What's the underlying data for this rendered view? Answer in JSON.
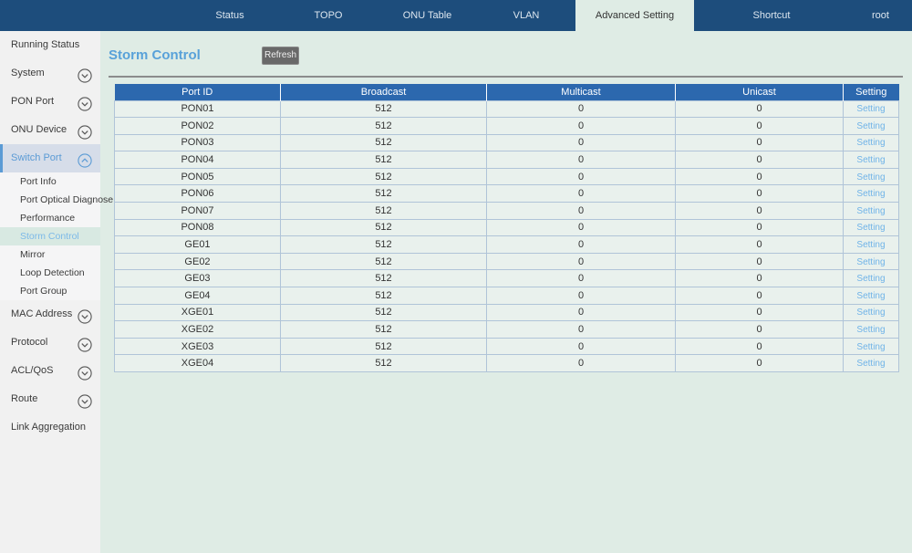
{
  "nav": {
    "tabs": [
      {
        "label": "Status",
        "active": false
      },
      {
        "label": "TOPO",
        "active": false
      },
      {
        "label": "ONU Table",
        "active": false
      },
      {
        "label": "VLAN",
        "active": false
      },
      {
        "label": "Advanced Setting",
        "active": true
      },
      {
        "label": "Shortcut",
        "active": false
      },
      {
        "label": "root",
        "active": false
      }
    ]
  },
  "sidebar": {
    "items": [
      {
        "label": "Running Status",
        "level": "top",
        "chevron": null,
        "active": false
      },
      {
        "label": "System",
        "level": "top",
        "chevron": "down",
        "active": false
      },
      {
        "label": "PON Port",
        "level": "top",
        "chevron": "down",
        "active": false
      },
      {
        "label": "ONU Device",
        "level": "top",
        "chevron": "down",
        "active": false
      },
      {
        "label": "Switch Port",
        "level": "top",
        "chevron": "up",
        "active": true
      },
      {
        "label": "Port Info",
        "level": "sub",
        "chevron": null,
        "active": false
      },
      {
        "label": "Port Optical Diagnose",
        "level": "sub",
        "chevron": null,
        "active": false
      },
      {
        "label": "Performance",
        "level": "sub",
        "chevron": null,
        "active": false
      },
      {
        "label": "Storm Control",
        "level": "sub",
        "chevron": null,
        "active": true
      },
      {
        "label": "Mirror",
        "level": "sub",
        "chevron": null,
        "active": false
      },
      {
        "label": "Loop Detection",
        "level": "sub",
        "chevron": null,
        "active": false
      },
      {
        "label": "Port Group",
        "level": "sub",
        "chevron": null,
        "active": false
      },
      {
        "label": "MAC Address",
        "level": "top",
        "chevron": "down",
        "active": false
      },
      {
        "label": "Protocol",
        "level": "top",
        "chevron": "down",
        "active": false
      },
      {
        "label": "ACL/QoS",
        "level": "top",
        "chevron": "down",
        "active": false
      },
      {
        "label": "Route",
        "level": "top",
        "chevron": "down",
        "active": false
      },
      {
        "label": "Link Aggregation",
        "level": "top",
        "chevron": null,
        "active": false
      }
    ]
  },
  "main": {
    "title": "Storm Control",
    "refresh_label": "Refresh",
    "table": {
      "headers": [
        "Port ID",
        "Broadcast",
        "Multicast",
        "Unicast",
        "Setting"
      ],
      "rows": [
        {
          "port_id": "PON01",
          "broadcast": "512",
          "multicast": "0",
          "unicast": "0",
          "setting": "Setting"
        },
        {
          "port_id": "PON02",
          "broadcast": "512",
          "multicast": "0",
          "unicast": "0",
          "setting": "Setting"
        },
        {
          "port_id": "PON03",
          "broadcast": "512",
          "multicast": "0",
          "unicast": "0",
          "setting": "Setting"
        },
        {
          "port_id": "PON04",
          "broadcast": "512",
          "multicast": "0",
          "unicast": "0",
          "setting": "Setting"
        },
        {
          "port_id": "PON05",
          "broadcast": "512",
          "multicast": "0",
          "unicast": "0",
          "setting": "Setting"
        },
        {
          "port_id": "PON06",
          "broadcast": "512",
          "multicast": "0",
          "unicast": "0",
          "setting": "Setting"
        },
        {
          "port_id": "PON07",
          "broadcast": "512",
          "multicast": "0",
          "unicast": "0",
          "setting": "Setting"
        },
        {
          "port_id": "PON08",
          "broadcast": "512",
          "multicast": "0",
          "unicast": "0",
          "setting": "Setting"
        },
        {
          "port_id": "GE01",
          "broadcast": "512",
          "multicast": "0",
          "unicast": "0",
          "setting": "Setting"
        },
        {
          "port_id": "GE02",
          "broadcast": "512",
          "multicast": "0",
          "unicast": "0",
          "setting": "Setting"
        },
        {
          "port_id": "GE03",
          "broadcast": "512",
          "multicast": "0",
          "unicast": "0",
          "setting": "Setting"
        },
        {
          "port_id": "GE04",
          "broadcast": "512",
          "multicast": "0",
          "unicast": "0",
          "setting": "Setting"
        },
        {
          "port_id": "XGE01",
          "broadcast": "512",
          "multicast": "0",
          "unicast": "0",
          "setting": "Setting"
        },
        {
          "port_id": "XGE02",
          "broadcast": "512",
          "multicast": "0",
          "unicast": "0",
          "setting": "Setting"
        },
        {
          "port_id": "XGE03",
          "broadcast": "512",
          "multicast": "0",
          "unicast": "0",
          "setting": "Setting"
        },
        {
          "port_id": "XGE04",
          "broadcast": "512",
          "multicast": "0",
          "unicast": "0",
          "setting": "Setting"
        }
      ]
    }
  },
  "colors": {
    "navbar_bg": "#1d4d7c",
    "content_bg": "#dfece5",
    "sidebar_bg": "#f1f1f1",
    "accent_blue": "#5b9bd5",
    "title_blue": "#58a1d9",
    "table_header_bg": "#2c68ae",
    "row_bg": "#e9f1ed",
    "table_border": "#b0c4d8",
    "link_blue": "#6fb3e8",
    "refresh_bg": "#696969"
  }
}
